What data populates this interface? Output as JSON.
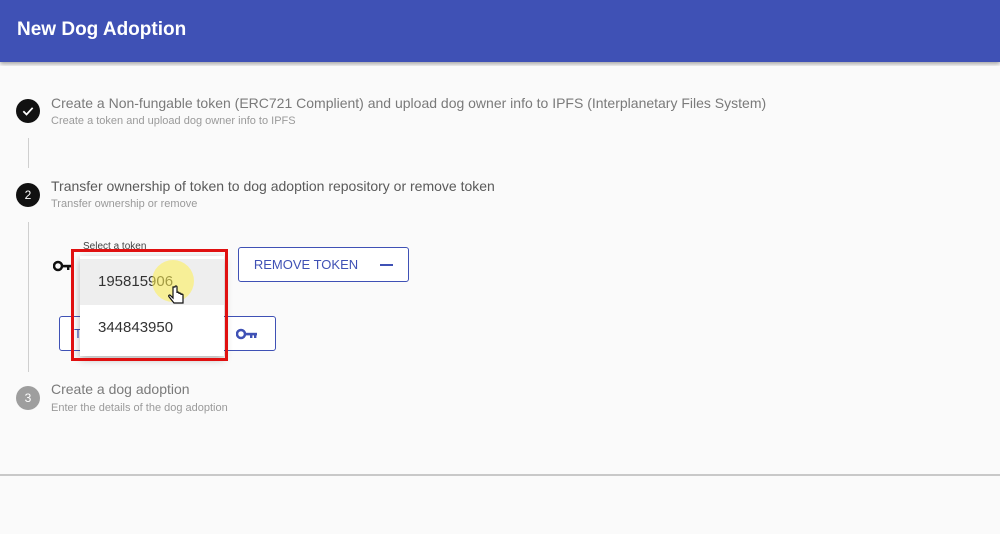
{
  "header": {
    "title": "New Dog Adoption"
  },
  "steps": [
    {
      "icon": "check-icon",
      "title": "Create a Non-fungable token (ERC721 Complient) and upload dog owner info to IPFS (Interplanetary Files System)",
      "subtitle": "Create a token and upload dog owner info to IPFS"
    },
    {
      "number": "2",
      "title": "Transfer ownership of token to dog adoption repository or remove token",
      "subtitle": "Transfer ownership or remove"
    },
    {
      "number": "3",
      "title": "Create a dog adoption",
      "subtitle": "Enter the details of the dog adoption"
    }
  ],
  "token_select": {
    "label": "Select a token",
    "options": [
      "195815906",
      "344843950"
    ]
  },
  "buttons": {
    "remove_token": "REMOVE TOKEN",
    "transfer_partial": "T"
  },
  "colors": {
    "primary": "#3f51b5",
    "highlight": "#e01010"
  }
}
